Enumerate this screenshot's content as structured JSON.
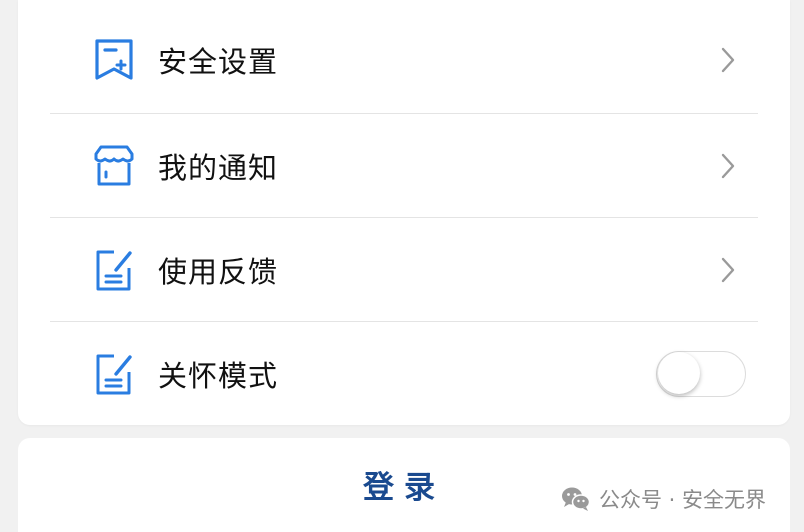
{
  "settings": {
    "items": [
      {
        "label": "安全设置",
        "icon": "bookmark-plus-icon",
        "control": "chevron"
      },
      {
        "label": "我的通知",
        "icon": "store-icon",
        "control": "chevron"
      },
      {
        "label": "使用反馈",
        "icon": "edit-note-icon",
        "control": "chevron"
      },
      {
        "label": "关怀模式",
        "icon": "edit-note-icon",
        "control": "toggle",
        "toggle_on": false
      }
    ]
  },
  "login": {
    "label": "登录"
  },
  "watermark": {
    "text": "公众号 · 安全无界"
  },
  "colors": {
    "accent": "#2a7de1",
    "login_text": "#1a4a8f",
    "chevron": "#9a9a9a"
  }
}
